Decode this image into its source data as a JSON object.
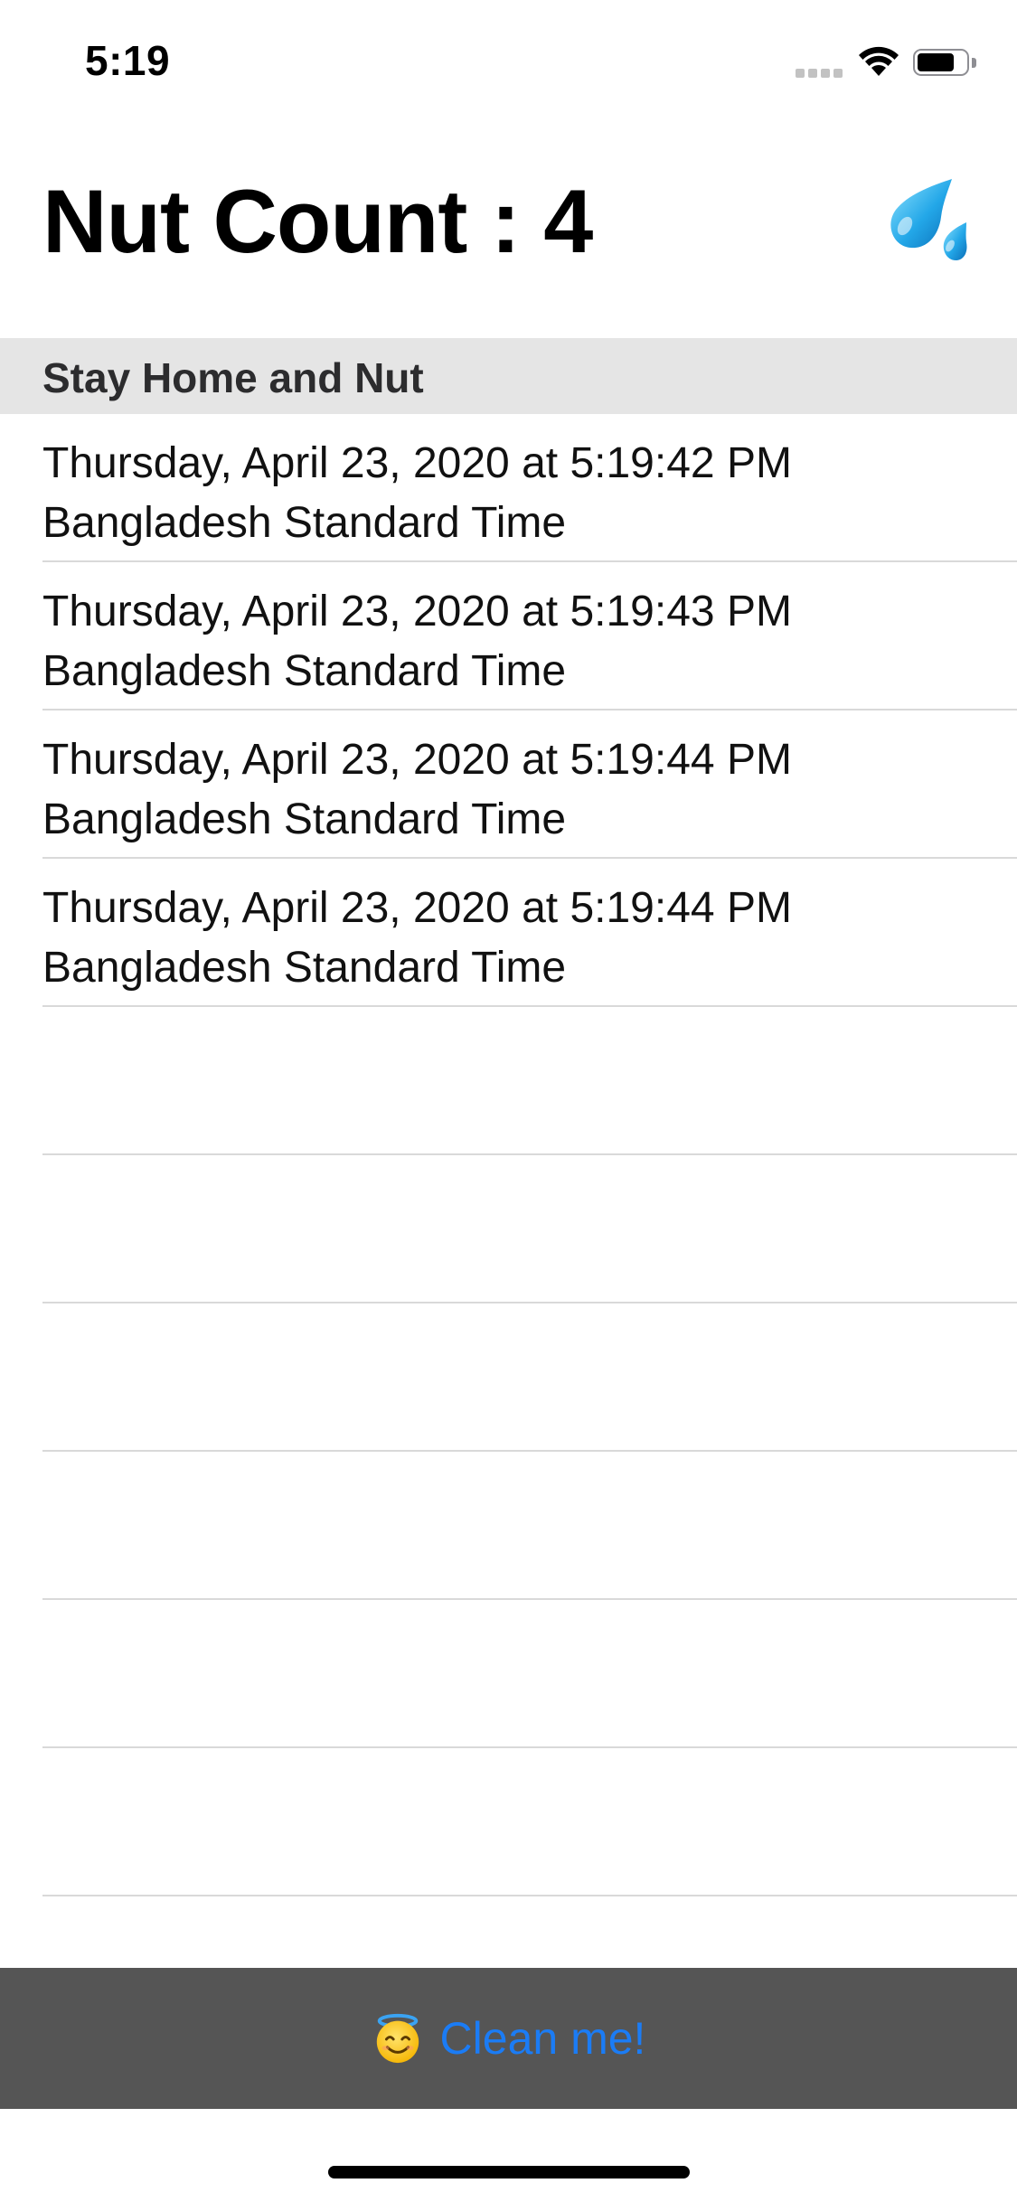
{
  "status_bar": {
    "time": "5:19",
    "signal_icon": "cellular-signal-icon",
    "wifi_icon": "wifi-icon",
    "battery_icon": "battery-icon",
    "battery_level": 0.7
  },
  "header": {
    "title": "Nut Count : 4",
    "action_icon": "sweat-droplets-emoji"
  },
  "section": {
    "title": "Stay Home and Nut"
  },
  "entries": [
    {
      "date": "Thursday, April 23, 2020 at 5:19:42 PM",
      "zone": "Bangladesh Standard Time"
    },
    {
      "date": "Thursday, April 23, 2020 at 5:19:43 PM",
      "zone": "Bangladesh Standard Time"
    },
    {
      "date": "Thursday, April 23, 2020 at 5:19:44 PM",
      "zone": "Bangladesh Standard Time"
    },
    {
      "date": "Thursday, April 23, 2020 at 5:19:44 PM",
      "zone": "Bangladesh Standard Time"
    }
  ],
  "empty_row_count": 6,
  "bottom_bar": {
    "button_icon": "smiling-face-with-halo-emoji",
    "button_label": "Clean me!"
  },
  "colors": {
    "section_background": "#e5e5e5",
    "bottom_bar_background": "#555555",
    "button_text": "#1b7cf5",
    "separator": "#d9d9d9"
  }
}
